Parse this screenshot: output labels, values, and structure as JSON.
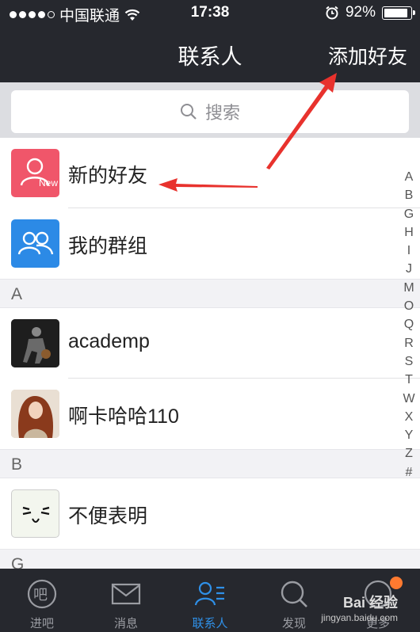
{
  "status": {
    "carrier": "中国联通",
    "time": "17:38",
    "battery": "92%",
    "battery_level": 0.92
  },
  "nav": {
    "title": "联系人",
    "add_label": "添加好友"
  },
  "search": {
    "placeholder": "搜索"
  },
  "top_rows": [
    {
      "name": "新的好友",
      "avatar_badge": "New",
      "icon": "new-friend-icon",
      "color": "#f0566a"
    },
    {
      "name": "我的群组",
      "icon": "group-icon",
      "color": "#2c8ae6"
    }
  ],
  "sections": [
    {
      "letter": "A",
      "contacts": [
        "academp",
        "啊卡哈哈110"
      ]
    },
    {
      "letter": "B",
      "contacts": [
        "不便表明"
      ]
    },
    {
      "letter": "G"
    }
  ],
  "index_letters": [
    "A",
    "B",
    "G",
    "H",
    "I",
    "J",
    "M",
    "O",
    "Q",
    "R",
    "S",
    "T",
    "W",
    "X",
    "Y",
    "Z",
    "#"
  ],
  "tabs": [
    {
      "label": "进吧",
      "icon": "enter-bar-icon"
    },
    {
      "label": "消息",
      "icon": "message-icon"
    },
    {
      "label": "联系人",
      "icon": "contacts-icon",
      "active": true
    },
    {
      "label": "发现",
      "icon": "discover-icon"
    },
    {
      "label": "更多",
      "icon": "more-icon"
    }
  ],
  "watermark": {
    "brand": "Bai 经验",
    "url": "jingyan.baidu.com"
  }
}
